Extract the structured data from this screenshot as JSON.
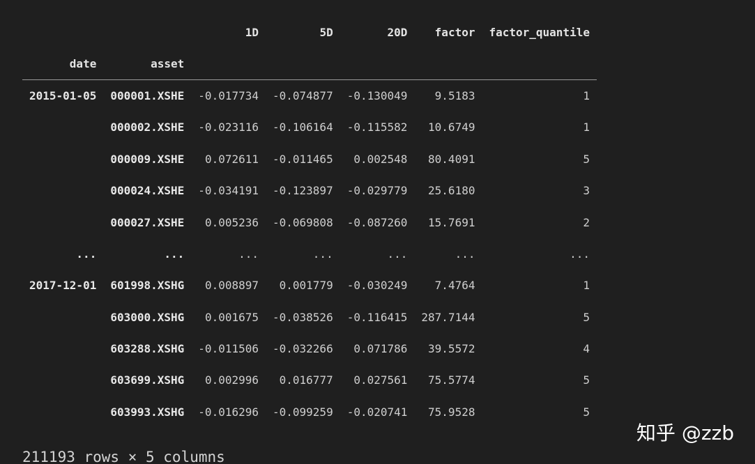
{
  "table": {
    "columns": [
      "1D",
      "5D",
      "20D",
      "factor",
      "factor_quantile"
    ],
    "index_names": [
      "date",
      "asset"
    ],
    "rows": [
      {
        "date": "2015-01-05",
        "asset": "000001.XSHE",
        "values": [
          "-0.017734",
          "-0.074877",
          "-0.130049",
          "9.5183",
          "1"
        ]
      },
      {
        "date": "",
        "asset": "000002.XSHE",
        "values": [
          "-0.023116",
          "-0.106164",
          "-0.115582",
          "10.6749",
          "1"
        ]
      },
      {
        "date": "",
        "asset": "000009.XSHE",
        "values": [
          "0.072611",
          "-0.011465",
          "0.002548",
          "80.4091",
          "5"
        ]
      },
      {
        "date": "",
        "asset": "000024.XSHE",
        "values": [
          "-0.034191",
          "-0.123897",
          "-0.029779",
          "25.6180",
          "3"
        ]
      },
      {
        "date": "",
        "asset": "000027.XSHE",
        "values": [
          "0.005236",
          "-0.069808",
          "-0.087260",
          "15.7691",
          "2"
        ]
      },
      {
        "date": "...",
        "asset": "...",
        "values": [
          "...",
          "...",
          "...",
          "...",
          "..."
        ]
      },
      {
        "date": "2017-12-01",
        "asset": "601998.XSHG",
        "values": [
          "0.008897",
          "0.001779",
          "-0.030249",
          "7.4764",
          "1"
        ]
      },
      {
        "date": "",
        "asset": "603000.XSHG",
        "values": [
          "0.001675",
          "-0.038526",
          "-0.116415",
          "287.7144",
          "5"
        ]
      },
      {
        "date": "",
        "asset": "603288.XSHG",
        "values": [
          "-0.011506",
          "-0.032266",
          "0.071786",
          "39.5572",
          "4"
        ]
      },
      {
        "date": "",
        "asset": "603699.XSHG",
        "values": [
          "0.002996",
          "0.016777",
          "0.027561",
          "75.5774",
          "5"
        ]
      },
      {
        "date": "",
        "asset": "603993.XSHG",
        "values": [
          "-0.016296",
          "-0.099259",
          "-0.020741",
          "75.9528",
          "5"
        ]
      }
    ]
  },
  "summary": "211193 rows × 5 columns",
  "watermark": "知乎 @zzb"
}
